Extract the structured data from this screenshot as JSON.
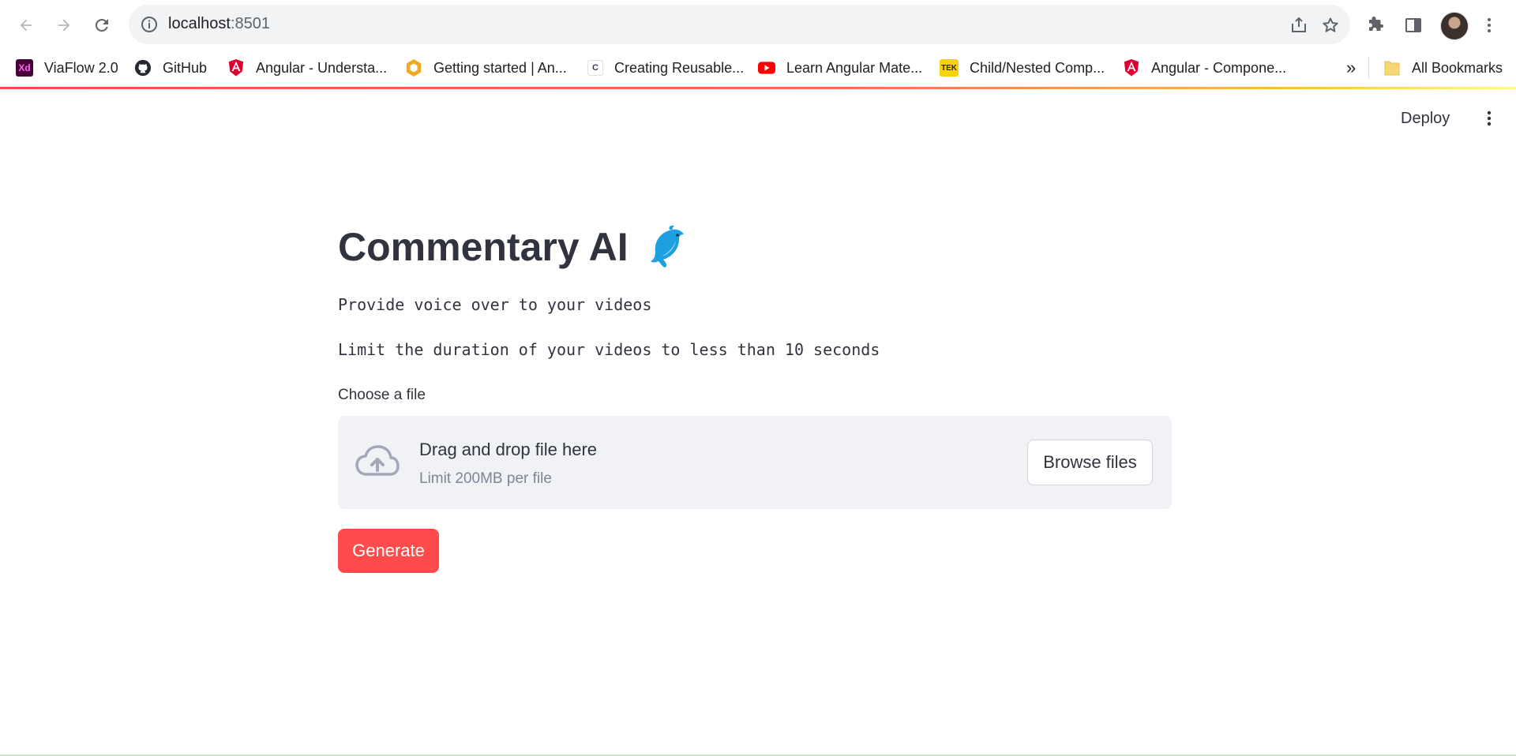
{
  "browser": {
    "url_host": "localhost",
    "url_port": ":8501",
    "bookmarks": [
      {
        "label": "ViaFlow 2.0",
        "icon": "adobe-xd-icon",
        "badge": "Xd",
        "color": "#470137"
      },
      {
        "label": "GitHub",
        "icon": "github-icon",
        "color": "#24292f"
      },
      {
        "label": "Angular - Understa...",
        "icon": "angular-icon",
        "color": "#dd0031"
      },
      {
        "label": "Getting started | An...",
        "icon": "hexagon-icon",
        "color": "#f5a623"
      },
      {
        "label": "Creating Reusable...",
        "icon": "c-icon",
        "badge": "C",
        "color": "#3b3b6d"
      },
      {
        "label": "Learn Angular Mate...",
        "icon": "youtube-icon",
        "color": "#ff0000"
      },
      {
        "label": "Child/Nested Comp...",
        "icon": "tek-icon",
        "badge": "TEK",
        "color": "#f7d300"
      },
      {
        "label": "Angular - Compone...",
        "icon": "angular-icon",
        "color": "#dd0031"
      }
    ],
    "overflow_label": "»",
    "all_bookmarks_label": "All Bookmarks"
  },
  "app": {
    "deploy_label": "Deploy",
    "title": "Commentary AI",
    "title_emoji": "dolphin-icon",
    "line1": "Provide voice over to your videos",
    "line2": "Limit the duration of your videos to less than 10 seconds",
    "uploader": {
      "label": "Choose a file",
      "drop_text": "Drag and drop file here",
      "limit_text": "Limit 200MB per file",
      "browse_label": "Browse files"
    },
    "generate_label": "Generate",
    "accent_color": "#ff4b4b"
  }
}
